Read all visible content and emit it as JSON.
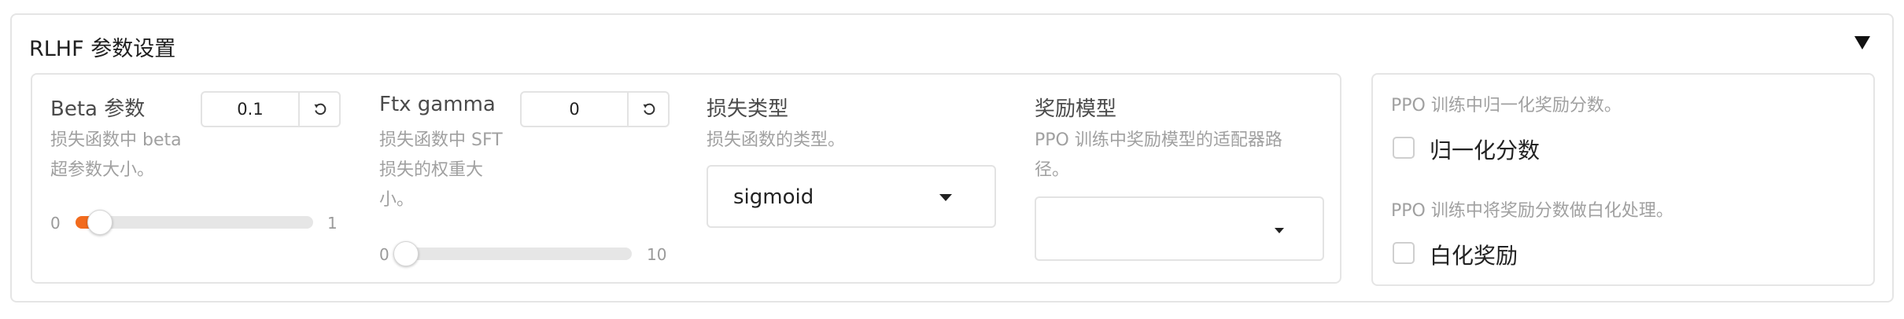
{
  "panel": {
    "title": "RLHF 参数设置",
    "collapse_icon": "triangle-down-icon"
  },
  "beta": {
    "label": "Beta 参数",
    "desc_lines": [
      "损失函数中 beta",
      "超参数大小。"
    ],
    "value": "0.1",
    "min": "0",
    "max": "1",
    "fraction": 0.1,
    "reset_icon": "reset-icon"
  },
  "ftx_gamma": {
    "label": "Ftx gamma",
    "desc_lines": [
      "损失函数中 SFT",
      "损失的权重大",
      "小。"
    ],
    "value": "0",
    "min": "0",
    "max": "10",
    "fraction": 0,
    "reset_icon": "reset-icon"
  },
  "loss_type": {
    "label": "损失类型",
    "desc": "损失函数的类型。",
    "selected": "sigmoid"
  },
  "reward_model": {
    "label": "奖励模型",
    "desc_lines": [
      "PPO 训练中奖励模型的适配器路",
      "径。"
    ],
    "selected": ""
  },
  "normalize_reward": {
    "desc": "PPO 训练中归一化奖励分数。",
    "label": "归一化分数",
    "checked": false
  },
  "whiten_reward": {
    "desc": "PPO 训练中将奖励分数做白化处理。",
    "label": "白化奖励",
    "checked": false
  },
  "colors": {
    "accent": "#f26b1d",
    "border": "#e5e5e5",
    "muted_text": "#a0a0a0"
  }
}
